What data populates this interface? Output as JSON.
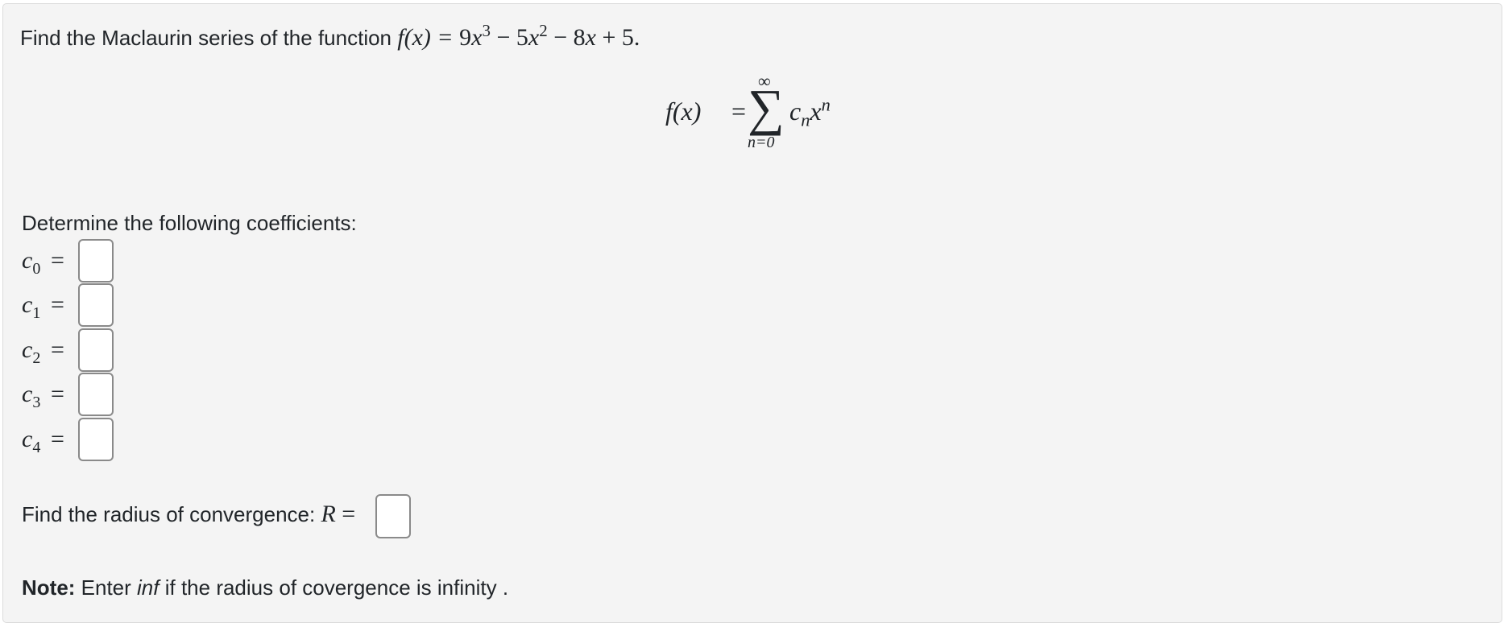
{
  "question": {
    "intro_text": "Find the Maclaurin series of the function ",
    "function_lhs": "f(x) = ",
    "function_terms": {
      "t1_coef": "9x",
      "t1_exp": "3",
      "t2": " − 5x",
      "t2_exp": "2",
      "t3": " − 8x + 5."
    },
    "series": {
      "lhs": "f(x)",
      "equals": "=",
      "sigma": "∑",
      "upper_limit": "∞",
      "lower_limit": "n=0",
      "term_c": "c",
      "term_c_sub": "n",
      "term_x": "x",
      "term_x_sup": "n"
    }
  },
  "coefficients": {
    "heading": "Determine the following coefficients:",
    "rows": [
      {
        "label": "c",
        "sub": "0",
        "equals": "=",
        "value": ""
      },
      {
        "label": "c",
        "sub": "1",
        "equals": "=",
        "value": ""
      },
      {
        "label": "c",
        "sub": "2",
        "equals": "=",
        "value": ""
      },
      {
        "label": "c",
        "sub": "3",
        "equals": "=",
        "value": ""
      },
      {
        "label": "c",
        "sub": "4",
        "equals": "=",
        "value": ""
      }
    ]
  },
  "radius": {
    "prompt": "Find the radius of convergence: ",
    "symbol": "R",
    "equals": " =",
    "value": ""
  },
  "note": {
    "label": "Note:",
    "text_before": " Enter ",
    "keyword": "inf",
    "text_after": " if the radius of covergence is infinity ."
  }
}
